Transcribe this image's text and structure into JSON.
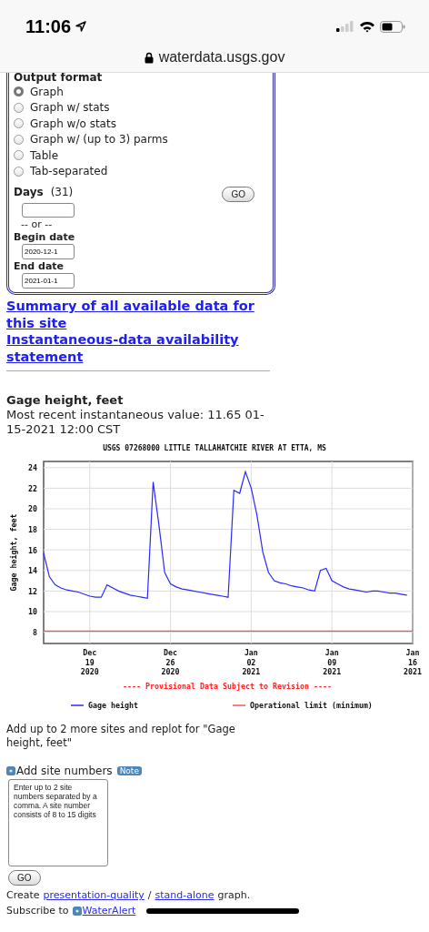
{
  "status_bar": {
    "time": "11:06"
  },
  "address_bar": {
    "url": "waterdata.usgs.gov"
  },
  "output_format": {
    "legend": "Output format",
    "options": [
      {
        "label": "Graph",
        "selected": true
      },
      {
        "label": "Graph w/ stats",
        "selected": false
      },
      {
        "label": "Graph w/o stats",
        "selected": false
      },
      {
        "label": "Graph w/ (up to 3) parms",
        "selected": false
      },
      {
        "label": "Table",
        "selected": false
      },
      {
        "label": "Tab-separated",
        "selected": false
      }
    ],
    "days_label": "Days",
    "days_hint": "(31)",
    "go": "GO",
    "or": "-- or --",
    "begin_label": "Begin date",
    "begin_value": "2020-12-1",
    "end_label": "End date",
    "end_value": "2021-01-1"
  },
  "links": [
    "Summary of all available data for this site",
    "Instantaneous-data availability statement"
  ],
  "parameter": {
    "title": "Gage height, feet",
    "recent": "Most recent instantaneous value: 11.65 01-15-2021   12:00 CST",
    "chart_data": {
      "type": "line",
      "title": "USGS 07268000 LITTLE TALLAHATCHIE RIVER AT ETTA, MS",
      "ylabel": "Gage height, feet",
      "categories": [
        null,
        null,
        null,
        null,
        null,
        null,
        null,
        null,
        "Dec 19 2020",
        null,
        null,
        null,
        null,
        null,
        null,
        null,
        null,
        null,
        null,
        null,
        null,
        null,
        "Dec 26 2020",
        null,
        null,
        null,
        null,
        null,
        null,
        null,
        null,
        null,
        null,
        null,
        null,
        null,
        "Jan 02 2021",
        null,
        null,
        null,
        null,
        null,
        null,
        null,
        null,
        null,
        null,
        null,
        null,
        null,
        "Jan 09 2021",
        null,
        null,
        null,
        null,
        null,
        null,
        null,
        null,
        null,
        null,
        null,
        null,
        null,
        "Jan 16 2021"
      ],
      "series": [
        {
          "name": "Gage height",
          "color": "#2a2aff",
          "values": [
            15.7,
            13.4,
            12.6,
            12.3,
            12.1,
            12.0,
            11.9,
            11.7,
            11.5,
            11.4,
            11.4,
            12.6,
            12.3,
            12.0,
            11.8,
            11.6,
            11.5,
            11.4,
            11.3,
            22.6,
            18.4,
            13.8,
            12.7,
            12.4,
            12.2,
            12.1,
            12.0,
            11.9,
            11.8,
            11.7,
            11.6,
            11.5,
            11.4,
            21.8,
            21.5,
            23.6,
            22.0,
            19.4,
            15.8,
            13.8,
            13.0,
            12.8,
            12.7,
            12.5,
            12.4,
            12.3,
            12.1,
            12.0,
            14.0,
            14.2,
            13.0,
            12.7,
            12.4,
            12.2,
            12.1,
            12.0,
            11.9,
            12.0,
            12.0,
            11.9,
            11.8,
            11.8,
            11.7,
            11.6,
            null
          ]
        },
        {
          "name": "Operational limit (minimum)",
          "color": "#ff5050",
          "values": [
            8.1,
            8.1,
            8.1,
            8.1,
            8.1,
            8.1,
            8.1,
            8.1,
            8.1,
            8.1,
            8.1,
            8.1,
            8.1,
            8.1,
            8.1,
            8.1,
            8.1,
            8.1,
            8.1,
            8.1,
            8.1,
            8.1,
            8.1,
            8.1,
            8.1,
            8.1,
            8.1,
            8.1,
            8.1,
            8.1,
            8.1,
            8.1,
            8.1,
            8.1,
            8.1,
            8.1,
            8.1,
            8.1,
            8.1,
            8.1,
            8.1,
            8.1,
            8.1,
            8.1,
            8.1,
            8.1,
            8.1,
            8.1,
            8.1,
            8.1,
            8.1,
            8.1,
            8.1,
            8.1,
            8.1,
            8.1,
            8.1,
            8.1,
            8.1,
            8.1,
            8.1,
            8.1,
            8.1,
            8.1,
            8.1
          ]
        }
      ],
      "ylim": [
        6.9,
        24.6
      ],
      "grid": true,
      "legend": true,
      "yticks": [
        8,
        10,
        12,
        14,
        16,
        18,
        20,
        22,
        24
      ],
      "annotations": [
        "---- Provisional Data Subject to Revision ----"
      ]
    }
  },
  "replot": {
    "text": "Add up to 2 more sites and replot for \"Gage height, feet\"",
    "label": "Add site numbers",
    "note": "Note",
    "placeholder": "Enter up to 2 site numbers separated by a comma. A site number consists of 8 to 15 digits",
    "go": "GO"
  },
  "footer": {
    "create_prefix": "Create",
    "link_1": "presentation-quality",
    "separator": "/",
    "link_2": "stand-alone",
    "create_suffix": "graph.",
    "subscribe_prefix": "Subscribe to",
    "subscribe_link": "WaterAlert"
  }
}
